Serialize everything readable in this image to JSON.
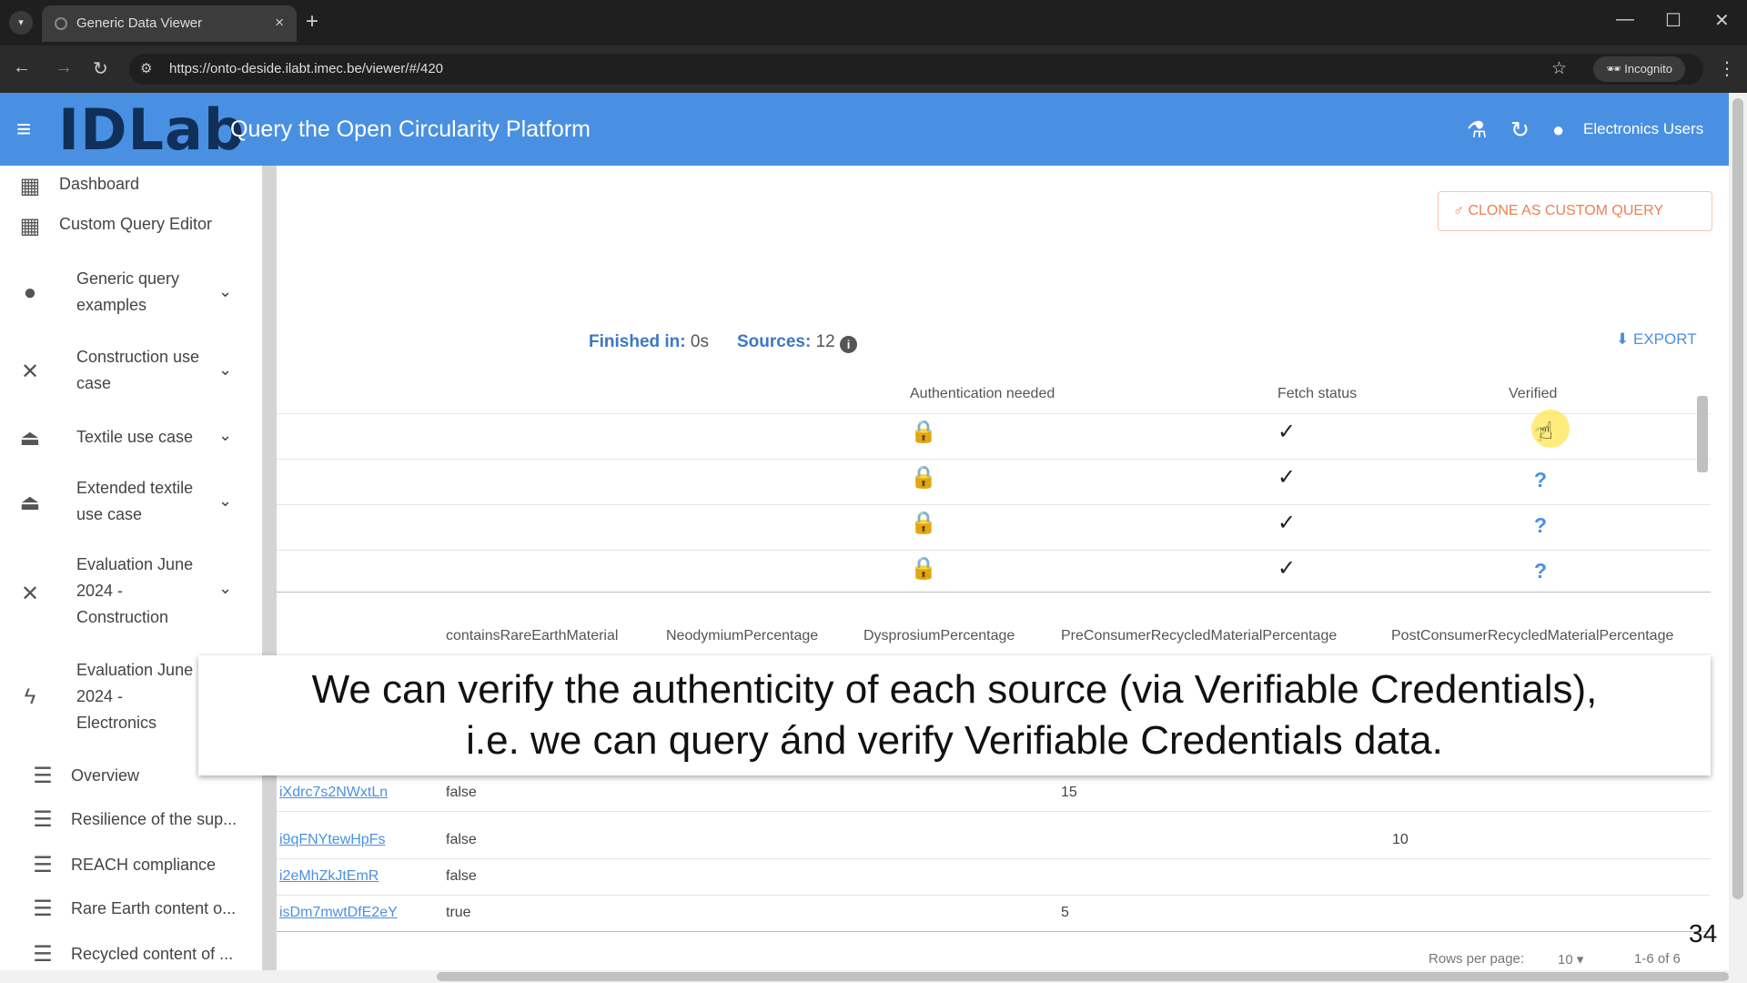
{
  "browser": {
    "tab_title": "Generic Data Viewer",
    "url": "https://onto-deside.ilabt.imec.be/viewer/#/420",
    "incognito_label": "Incognito"
  },
  "header": {
    "logo": "IDLab",
    "title": "Query the Open Circularity Platform",
    "user": "Electronics Users",
    "color": "#4a90e2"
  },
  "sidebar": {
    "items": [
      {
        "label": "Dashboard",
        "icon": "dashboard-icon"
      },
      {
        "label": "Custom Query Editor",
        "icon": "add-query-icon"
      },
      {
        "label_1": "Generic query",
        "label_2": "examples",
        "icon": "info-icon"
      },
      {
        "label_1": "Construction use",
        "label_2": "case",
        "icon": "tools-icon"
      },
      {
        "label": "Textile use case",
        "icon": "hanger-icon"
      },
      {
        "label_1": "Extended textile",
        "label_2": "use case",
        "icon": "hanger-icon"
      },
      {
        "label_1": "Evaluation June",
        "label_2": "2024 -",
        "label_3": "Construction",
        "icon": "tools-icon"
      },
      {
        "label_1": "Evaluation June",
        "label_2": "2024 -",
        "label_3": "Electronics",
        "icon": "bolt-icon"
      },
      {
        "label": "Overview",
        "icon": "list-icon"
      },
      {
        "label": "Resilience of the sup...",
        "icon": "list-icon"
      },
      {
        "label": "REACH compliance",
        "icon": "list-icon"
      },
      {
        "label": "Rare Earth content o...",
        "icon": "list-icon"
      },
      {
        "label": "Recycled content of ...",
        "icon": "list-icon"
      }
    ]
  },
  "main": {
    "clone_button": "CLONE AS CUSTOM QUERY",
    "finished_label": "Finished in:",
    "finished_value": "0s",
    "sources_label": "Sources:",
    "sources_value": "12",
    "export_label": "EXPORT",
    "source_columns": [
      "Authentication needed",
      "Fetch status",
      "Verified"
    ],
    "source_rows": [
      {
        "auth": "🔒",
        "fetch": "✓",
        "verified": "?"
      },
      {
        "auth": "🔒",
        "fetch": "✓",
        "verified": "?"
      },
      {
        "auth": "🔒",
        "fetch": "✓",
        "verified": "?"
      },
      {
        "auth": "🔒",
        "fetch": "✓",
        "verified": "?"
      }
    ],
    "data_columns": [
      "containsRareEarthMaterial",
      "NeodymiumPercentage",
      "DysprosiumPercentage",
      "PreConsumerRecycledMaterialPercentage",
      "PostConsumerRecycledMaterialPercentage"
    ],
    "data_rows": [
      {
        "id": "iXdrc7s2NWxtLn",
        "rare": "false",
        "pre": "15",
        "post": ""
      },
      {
        "id": "i9qFNYtewHpFs",
        "rare": "false",
        "pre": "",
        "post": "10"
      },
      {
        "id": "i2eMhZkJtEmR",
        "rare": "false",
        "pre": "",
        "post": ""
      },
      {
        "id": "isDm7mwtDfE2eY",
        "rare": "true",
        "pre": "5",
        "post": ""
      }
    ],
    "pager": {
      "rows_per_page_label": "Rows per page:",
      "rows_per_page": "10",
      "range": "1-6 of 6"
    }
  },
  "caption": {
    "line1": "We can verify the authenticity of each source (via Verifiable Credentials),",
    "line2": "i.e. we can query ánd verify Verifiable Credentials data."
  },
  "slide_number": "34"
}
